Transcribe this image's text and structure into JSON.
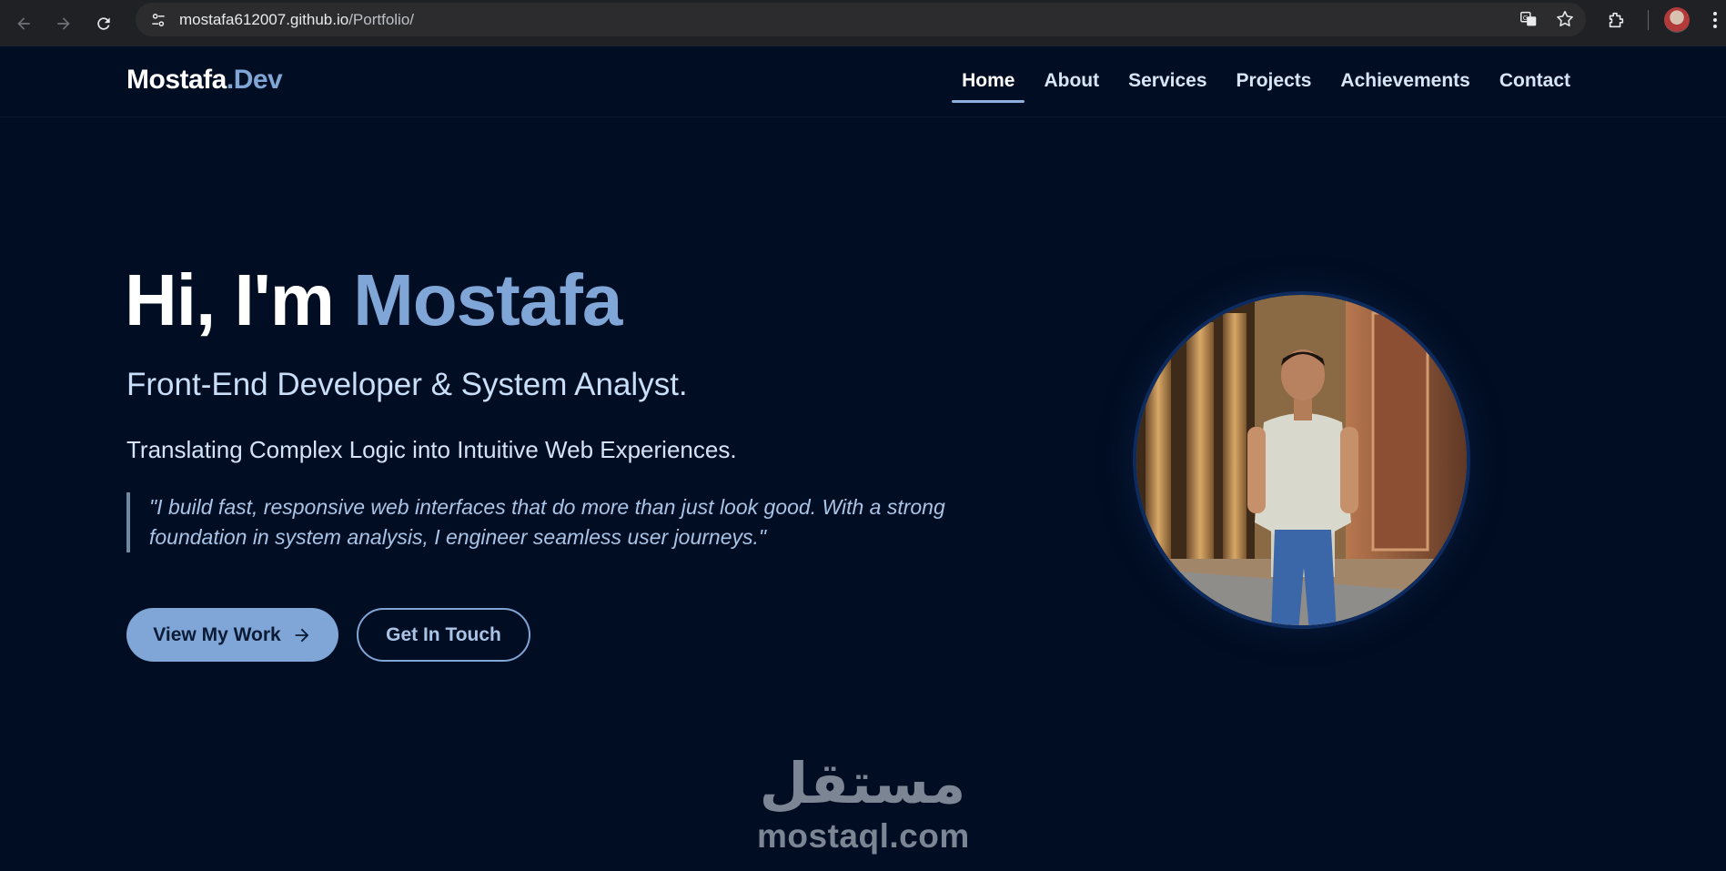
{
  "browser": {
    "url_host": "mostafa612007.github.io",
    "url_path": "/Portfolio/"
  },
  "site": {
    "logo_main": "Mostafa",
    "logo_accent": ".Dev",
    "nav": [
      {
        "label": "Home",
        "active": true
      },
      {
        "label": "About"
      },
      {
        "label": "Services"
      },
      {
        "label": "Projects"
      },
      {
        "label": "Achievements"
      },
      {
        "label": "Contact"
      }
    ]
  },
  "hero": {
    "greeting": "Hi, I'm ",
    "name": "Mostafa",
    "subtitle": "Front-End Developer & System Analyst.",
    "tagline": "Translating Complex Logic into Intuitive Web Experiences.",
    "quote": "\"I build fast, responsive web interfaces that do more than just look good. With a strong foundation in system analysis, I engineer seamless user journeys.\"",
    "primary_button": "View My Work",
    "secondary_button": "Get In Touch"
  },
  "watermark": {
    "arabic": "مستقل",
    "latin": "mostaql.com"
  },
  "colors": {
    "background": "#010d22",
    "accent": "#7fa6d6",
    "chrome": "#202124"
  }
}
